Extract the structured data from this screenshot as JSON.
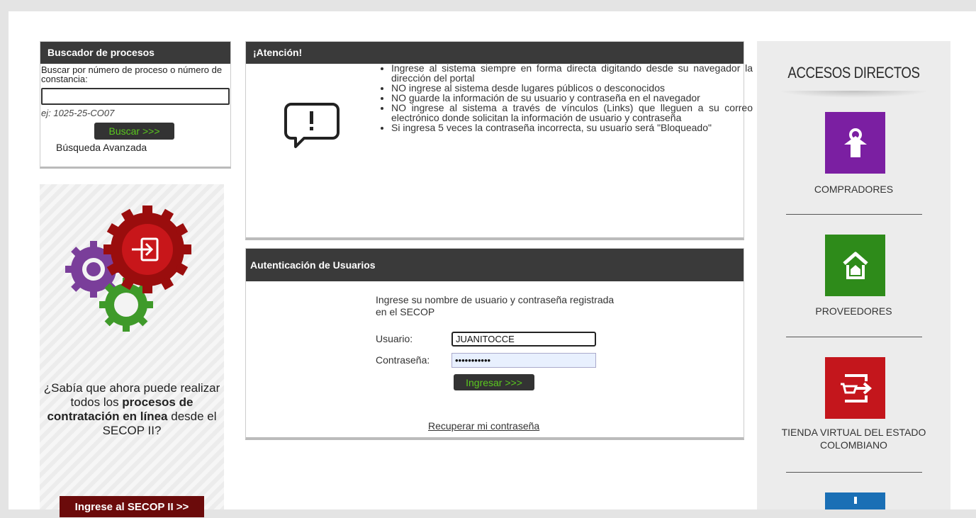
{
  "search": {
    "title": "Buscador de procesos",
    "label": "Buscar por número de proceso o número de constancia:",
    "input_value": "",
    "example": "ej: 1025-25-CO07",
    "button": "Buscar >>>",
    "advanced_link": "Búsqueda Avanzada"
  },
  "promo": {
    "text_prefix": "¿Sabía que ahora puede realizar todos los ",
    "text_bold": "procesos de contratación en línea",
    "text_suffix": " desde el SECOP II?",
    "button": "Ingrese al SECOP II >>"
  },
  "attention": {
    "title": "¡Atención!",
    "items": [
      "Ingrese al sistema siempre en forma directa digitando desde su navegador la dirección del portal",
      "NO ingrese al sistema desde lugares públicos o desconocidos",
      "NO guarde la información de su usuario y contraseña en el navegador",
      "NO ingrese al sistema a través de vínculos (Links) que lleguen a su correo electrónico donde solicitan la información de usuario y contraseña",
      "Si ingresa 5 veces la contraseña incorrecta, su usuario será \"Bloqueado\""
    ]
  },
  "auth": {
    "title": "Autenticación de Usuarios",
    "intro": "Ingrese su nombre de usuario y contraseña registrada en el SECOP",
    "user_label": "Usuario:",
    "user_value": "JUANITOCCE",
    "password_label": "Contraseña:",
    "password_value": "•••••••••••",
    "submit": "Ingresar >>>",
    "recover": "Recuperar mi contraseña"
  },
  "quick_access": {
    "title": "ACCESOS DIRECTOS",
    "tiles": [
      {
        "label": "COMPRADORES",
        "color": "#7b1fa2",
        "icon": "buyer-icon"
      },
      {
        "label": "PROVEEDORES",
        "color": "#2e8b1a",
        "icon": "supplier-icon"
      },
      {
        "label": "TIENDA VIRTUAL DEL ESTADO COLOMBIANO",
        "color": "#c4161c",
        "icon": "virtual-store-icon"
      },
      {
        "label": "",
        "color": "#1a6fb5",
        "icon": "info-icon"
      }
    ]
  }
}
